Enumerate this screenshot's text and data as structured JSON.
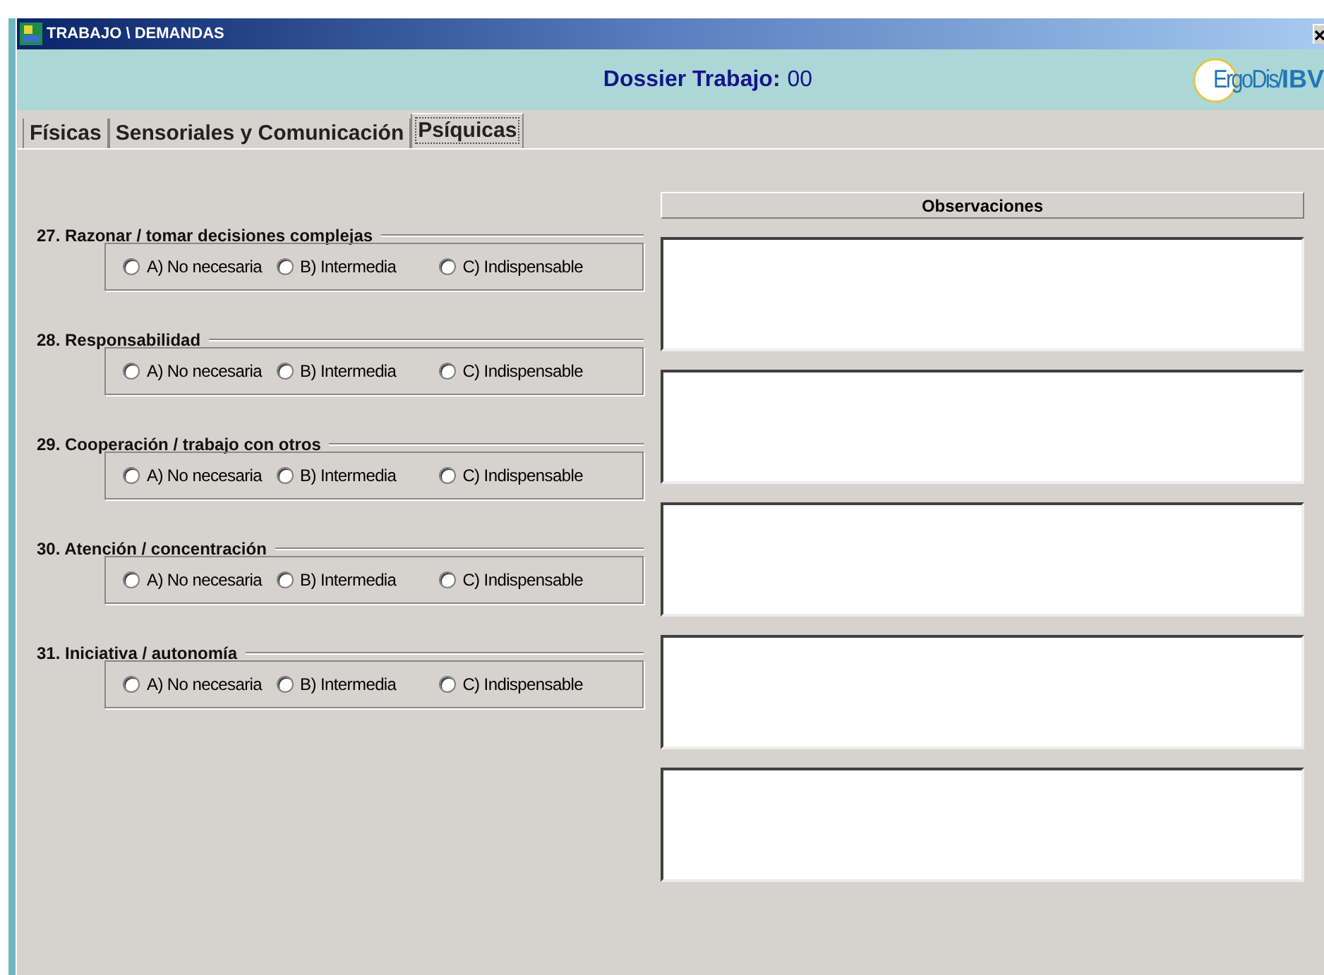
{
  "window": {
    "title": "TRABAJO \\ DEMANDAS"
  },
  "header": {
    "label": "Dossier Trabajo:",
    "value": "00",
    "logo": {
      "text": "ErgoDis/",
      "brand": "IBV"
    }
  },
  "tabs": [
    {
      "label": "Físicas",
      "selected": false
    },
    {
      "label": "Sensoriales y Comunicación",
      "selected": false
    },
    {
      "label": "Psíquicas",
      "selected": true
    }
  ],
  "observations_header": "Observaciones",
  "questions": [
    {
      "label": "27. Razonar / tomar decisiones complejas",
      "options": [
        {
          "label": "A) No necesaria",
          "selected": false
        },
        {
          "label": "B) Intermedia",
          "selected": false
        },
        {
          "label": "C) Indispensable",
          "selected": false
        }
      ]
    },
    {
      "label": "28. Responsabilidad",
      "options": [
        {
          "label": "A) No necesaria",
          "selected": false
        },
        {
          "label": "B) Intermedia",
          "selected": false
        },
        {
          "label": "C) Indispensable",
          "selected": false
        }
      ]
    },
    {
      "label": "29. Cooperación / trabajo con otros",
      "options": [
        {
          "label": "A) No necesaria",
          "selected": false
        },
        {
          "label": "B) Intermedia",
          "selected": false
        },
        {
          "label": "C) Indispensable",
          "selected": false
        }
      ]
    },
    {
      "label": "30. Atención / concentración",
      "options": [
        {
          "label": "A) No necesaria",
          "selected": false
        },
        {
          "label": "B) Intermedia",
          "selected": false
        },
        {
          "label": "C) Indispensable",
          "selected": false
        }
      ]
    },
    {
      "label": "31. Iniciativa / autonomía",
      "options": [
        {
          "label": "A) No necesaria",
          "selected": false
        },
        {
          "label": "B) Intermedia",
          "selected": false
        },
        {
          "label": "C) Indispensable",
          "selected": false
        }
      ]
    }
  ]
}
